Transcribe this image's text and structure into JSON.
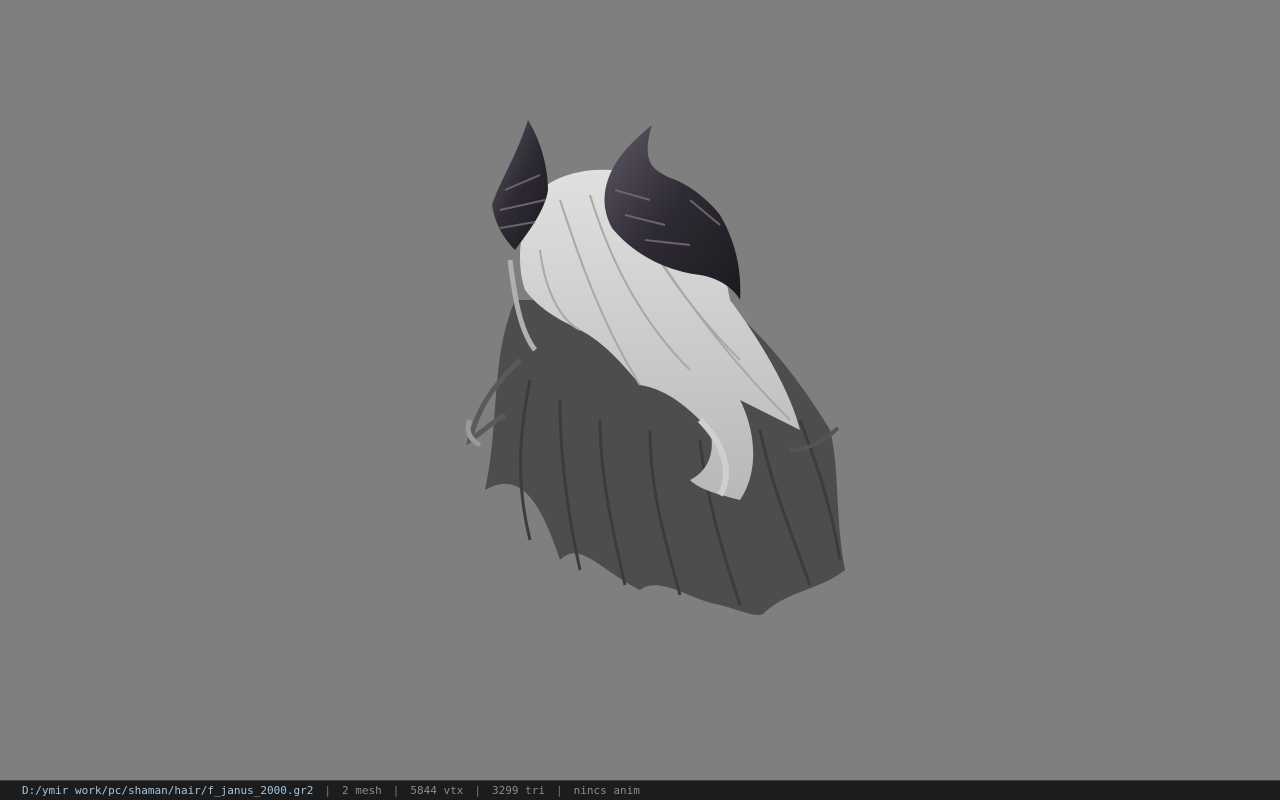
{
  "viewport": {
    "background_color": "#7f7f7f",
    "model": {
      "hair_light_color": "#d4d4d4",
      "hair_dark_color": "#4a4a4a",
      "horn_color": "#2e2a33",
      "horn_highlight_color": "#6a6470"
    }
  },
  "status_bar": {
    "file_path": "D:/ymir work/pc/shaman/hair/f_janus_2000.gr2",
    "separator": "|",
    "mesh_count": "2 mesh",
    "vertex_count": "5844 vtx",
    "triangle_count": "3299 tri",
    "animation": "nincs anim",
    "background_color": "#1c1c1c"
  }
}
